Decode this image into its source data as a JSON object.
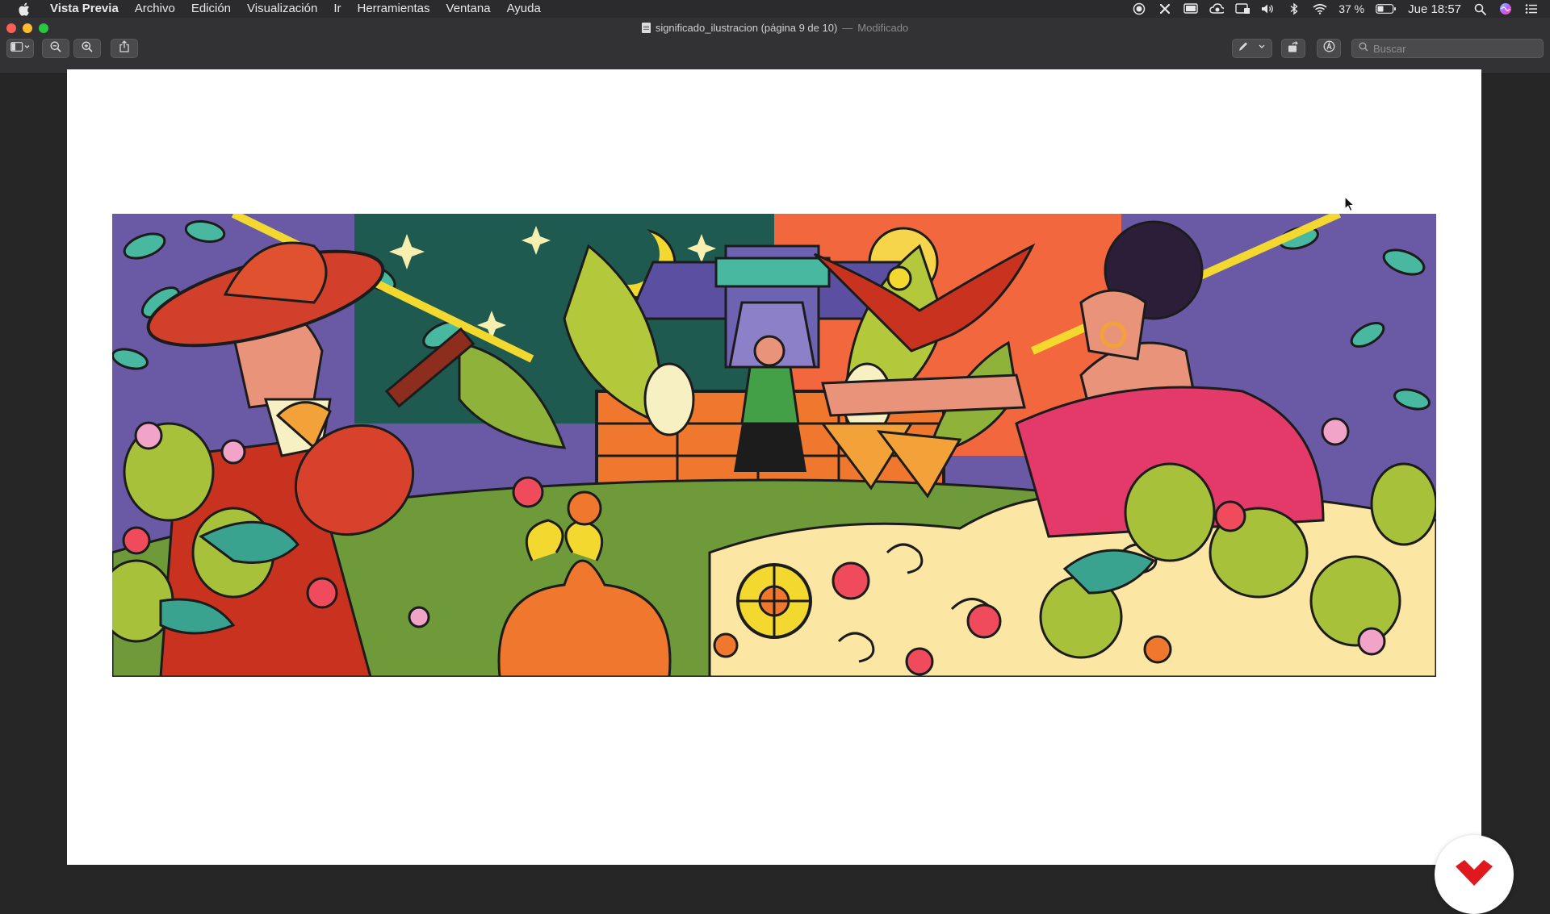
{
  "menubar": {
    "app_name": "Vista Previa",
    "items": [
      "Archivo",
      "Edición",
      "Visualización",
      "Ir",
      "Herramientas",
      "Ventana",
      "Ayuda"
    ],
    "battery_percent": "37 %",
    "clock": "Jue 18:57"
  },
  "window": {
    "file_name": "significado_ilustracion (página 9 de 10)",
    "separator": "—",
    "status": "Modificado"
  },
  "toolbar": {
    "search_placeholder": "Buscar",
    "icons": [
      "sidebar-icon",
      "zoom-out-icon",
      "zoom-in-icon",
      "share-icon",
      "markup-pen-icon",
      "rotate-icon",
      "annotate-icon",
      "search-icon"
    ]
  },
  "colors": {
    "accent": "#e0191f",
    "page_bg": "#ffffff",
    "window_bg": "#262626"
  }
}
